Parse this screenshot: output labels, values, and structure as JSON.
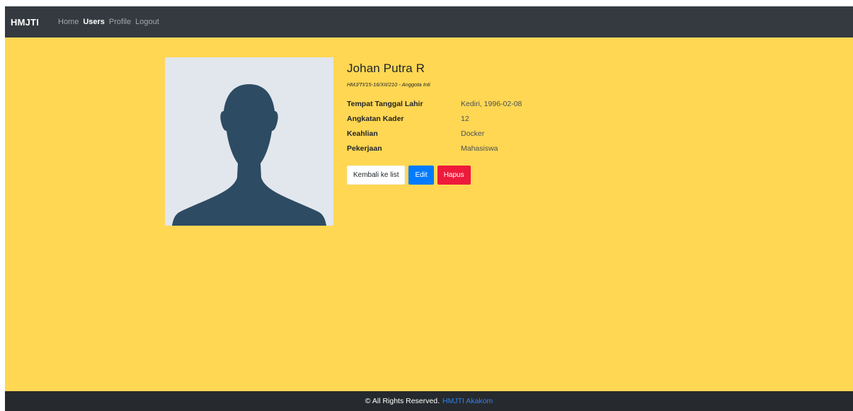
{
  "navbar": {
    "brand": "HMJTI",
    "links": [
      {
        "label": "Home",
        "active": false
      },
      {
        "label": "Users",
        "active": true
      },
      {
        "label": "Profile",
        "active": false
      },
      {
        "label": "Logout",
        "active": false
      }
    ]
  },
  "profile": {
    "photo_icon": "avatar-silhouette-icon",
    "name": "Johan Putra R",
    "subtitle": "HMJ/TI/15-16/XII/210 - Anggota Inti",
    "fields": [
      {
        "label": "Tempat Tanggal Lahir",
        "value": "Kediri, 1996-02-08"
      },
      {
        "label": "Angkatan Kader",
        "value": "12"
      },
      {
        "label": "Keahlian",
        "value": "Docker"
      },
      {
        "label": "Pekerjaan",
        "value": "Mahasiswa"
      }
    ]
  },
  "actions": {
    "back_label": "Kembali ke list",
    "edit_label": "Edit",
    "delete_label": "Hapus"
  },
  "footer": {
    "text": "© All Rights Reserved.",
    "link": "HMJTI Akakom"
  },
  "colors": {
    "page_background": "#ffd753",
    "navbar": "#343a40",
    "footer": "#262a2e",
    "primary": "#007bff",
    "danger": "#ee1a3b",
    "avatar": "#2d4b63"
  }
}
